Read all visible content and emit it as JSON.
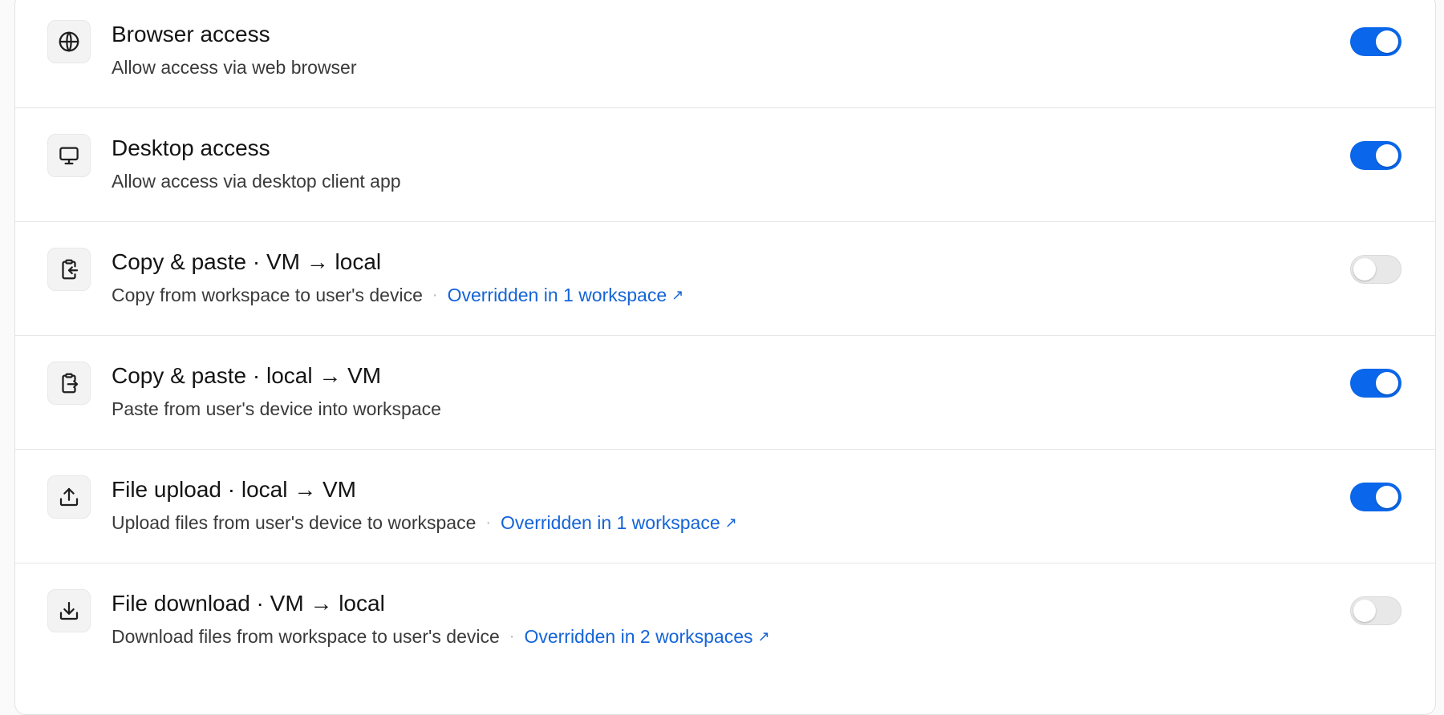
{
  "accent_color": "#0a66ea",
  "link_color": "#1464d8",
  "settings": [
    {
      "icon": "globe-icon",
      "title": "Browser access",
      "description": "Allow access via web browser",
      "override": "",
      "enabled": true
    },
    {
      "icon": "monitor-icon",
      "title": "Desktop access",
      "description": "Allow access via desktop client app",
      "override": "",
      "enabled": true
    },
    {
      "icon": "clipboard-in-icon",
      "title": "Copy & paste · VM → local",
      "description": "Copy from workspace to user's device",
      "override": "Overridden in 1 workspace",
      "enabled": false
    },
    {
      "icon": "clipboard-out-icon",
      "title": "Copy & paste · local → VM",
      "description": "Paste from user's device into workspace",
      "override": "",
      "enabled": true
    },
    {
      "icon": "upload-icon",
      "title": "File upload · local → VM",
      "description": "Upload files from user's device to workspace",
      "override": "Overridden in 1 workspace",
      "enabled": true
    },
    {
      "icon": "download-icon",
      "title": "File download · VM → local",
      "description": "Download files from workspace to user's device",
      "override": "Overridden in 2 workspaces",
      "enabled": false
    }
  ]
}
